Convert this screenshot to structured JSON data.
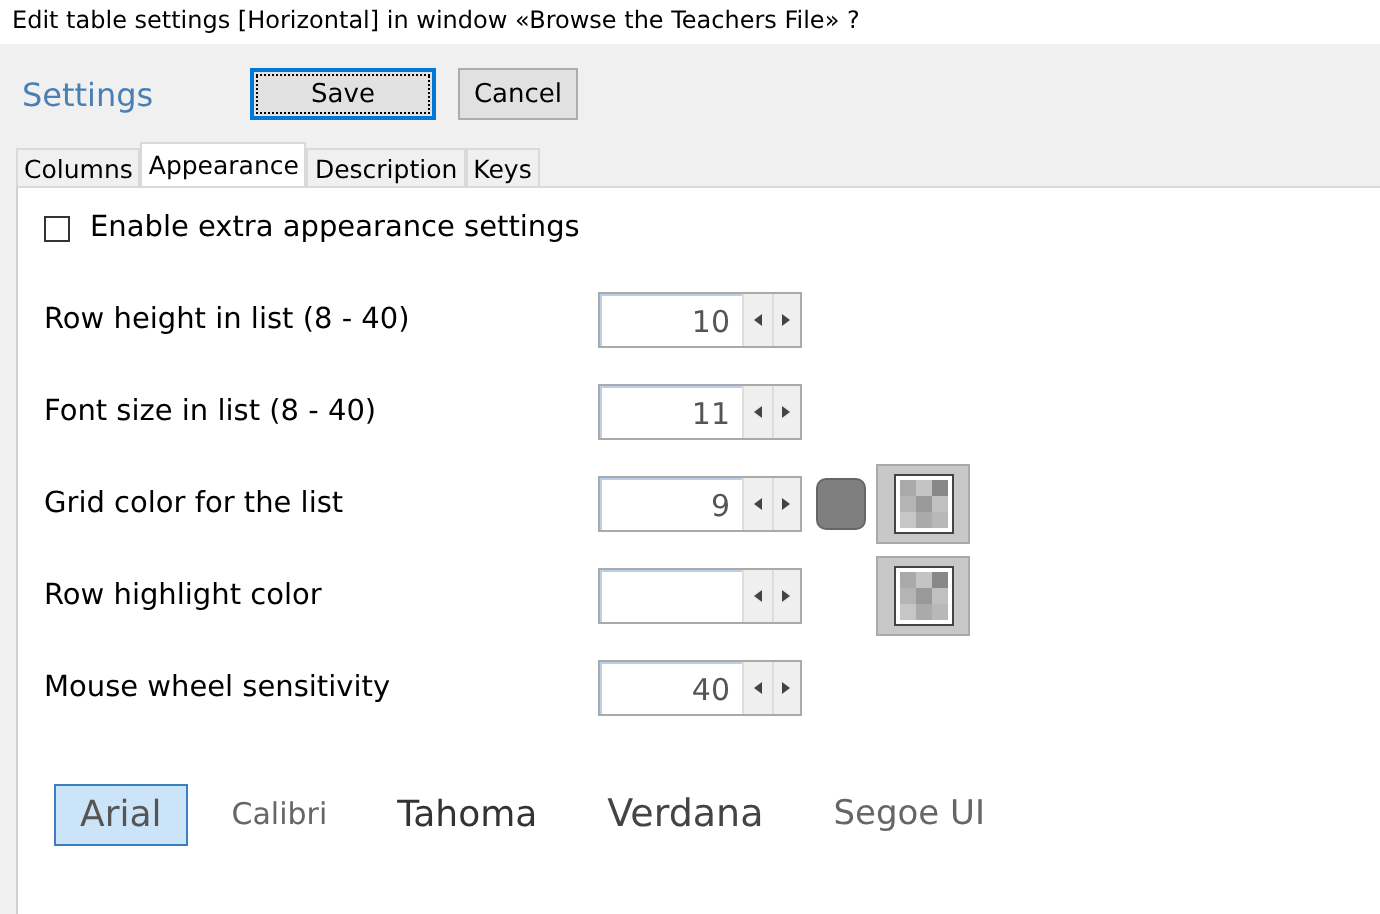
{
  "window": {
    "title": "Edit table settings [Horizontal] in window «Browse the Teachers File» ?"
  },
  "header": {
    "title": "Settings",
    "buttons": [
      {
        "label": "Save",
        "focused": true
      },
      {
        "label": "Cancel",
        "focused": false
      }
    ]
  },
  "tabs": [
    {
      "label": "Columns",
      "selected": false
    },
    {
      "label": "Appearance",
      "selected": true
    },
    {
      "label": "Description",
      "selected": false
    },
    {
      "label": "Keys",
      "selected": false
    }
  ],
  "extra_settings": {
    "label": "Enable extra appearance settings",
    "checked": false
  },
  "rows": [
    {
      "label": "Row height in list (8 - 40)",
      "value": "10",
      "pattern_button": false
    },
    {
      "label": "Font size in list (8 - 40)",
      "value": "11",
      "pattern_button": false
    },
    {
      "label": "Grid color for the list",
      "value": "9",
      "color": "#7f7f7f",
      "pattern_button": true
    },
    {
      "label": "Row highlight color",
      "value": "",
      "pattern_button": true
    },
    {
      "label": "Mouse wheel sensitivity",
      "value": "40",
      "pattern_button": false
    }
  ],
  "fonts": [
    {
      "label": "Arial",
      "selected": true
    },
    {
      "label": "Calibri",
      "selected": false
    },
    {
      "label": "Tahoma",
      "selected": false
    },
    {
      "label": "Verdana",
      "selected": false
    },
    {
      "label": "Segoe UI",
      "selected": false
    }
  ]
}
